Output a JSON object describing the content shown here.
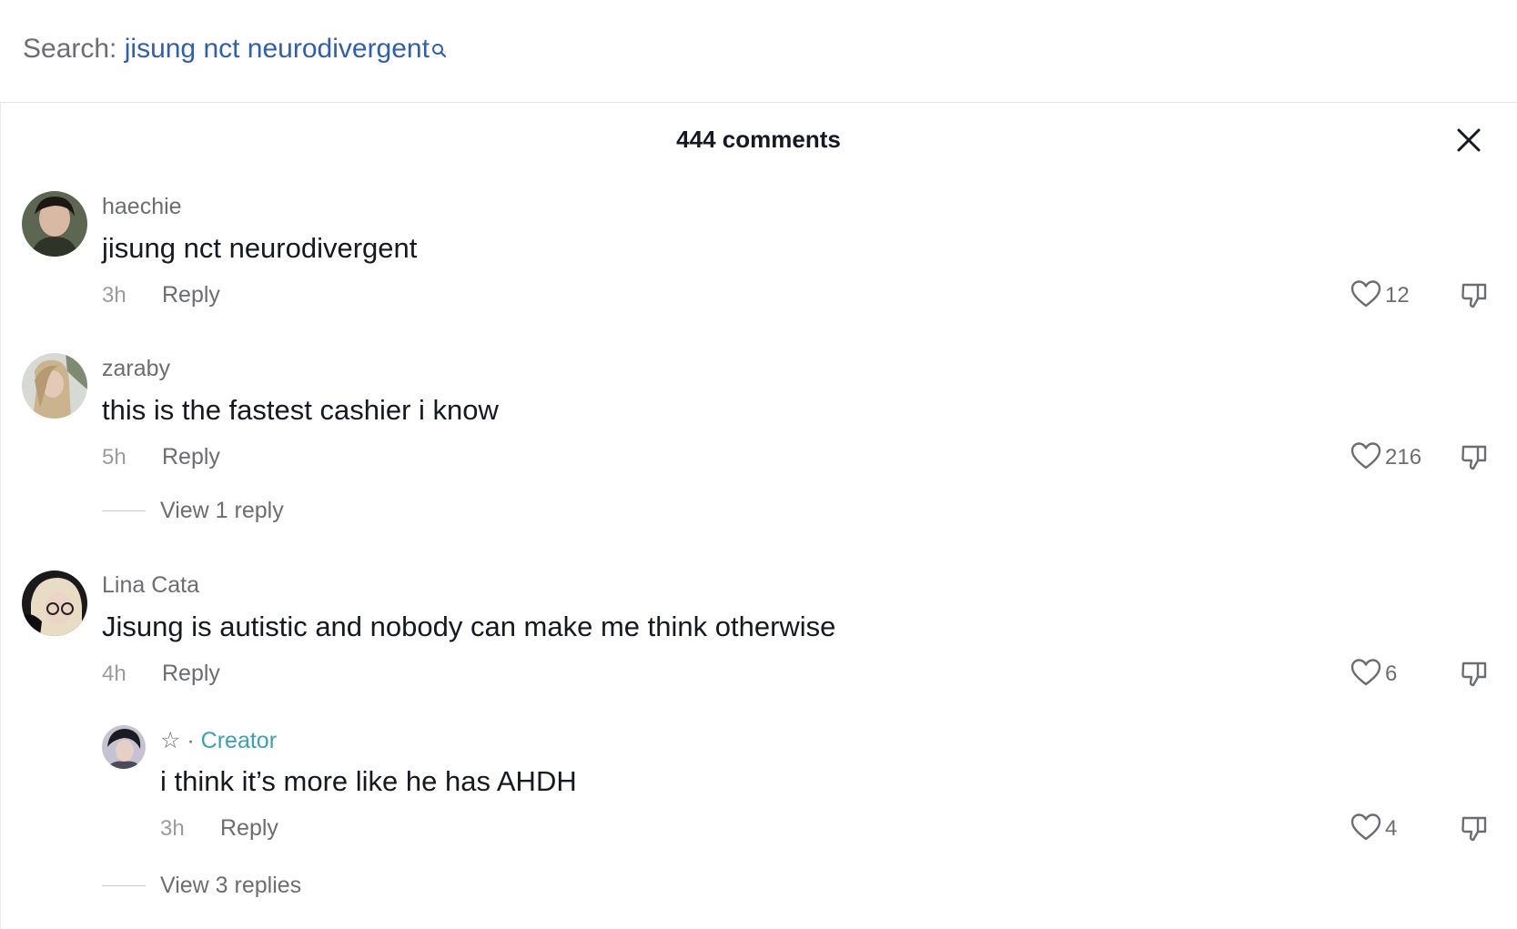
{
  "search": {
    "label": "Search:",
    "query": "jisung nct neurodivergent"
  },
  "header": {
    "title": "444 comments"
  },
  "comments": [
    {
      "username": "haechie",
      "text": "jisung nct neurodivergent",
      "time": "3h",
      "reply_label": "Reply",
      "likes": "12"
    },
    {
      "username": "zaraby",
      "text": "this is the fastest cashier i know",
      "time": "5h",
      "reply_label": "Reply",
      "likes": "216",
      "view_replies": "View 1 reply"
    },
    {
      "username": "Lina Cata",
      "text": "Jisung is autistic and nobody can make me think otherwise",
      "time": "4h",
      "reply_label": "Reply",
      "likes": "6",
      "view_replies": "View 3 replies",
      "reply": {
        "username": "☆",
        "separator": "·",
        "badge": "Creator",
        "text": "i think it’s more like he has AHDH",
        "time": "3h",
        "reply_label": "Reply",
        "likes": "4"
      }
    }
  ],
  "colors": {
    "query": "#2f5fb3",
    "creator_badge": "#3aa0b8",
    "text_primary": "#161823",
    "text_secondary": "#6b6d73"
  },
  "icons": {
    "search": "search-icon",
    "close": "close-icon",
    "like": "heart-outline-icon",
    "dislike": "thumbs-down-icon"
  }
}
